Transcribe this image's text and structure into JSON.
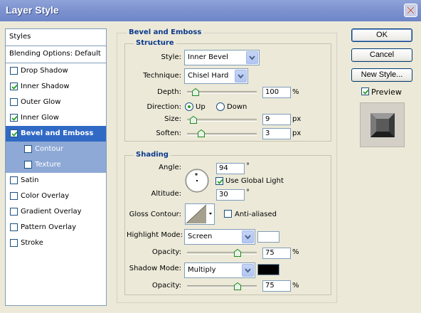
{
  "window": {
    "title": "Layer Style"
  },
  "styles_panel": {
    "header": "Styles",
    "blending": "Blending Options: Default",
    "items": [
      {
        "label": "Drop Shadow",
        "checked": false
      },
      {
        "label": "Inner Shadow",
        "checked": true
      },
      {
        "label": "Outer Glow",
        "checked": false
      },
      {
        "label": "Inner Glow",
        "checked": true
      },
      {
        "label": "Bevel and Emboss",
        "checked": true,
        "selected": true
      },
      {
        "label": "Contour",
        "checked": false,
        "sub": true
      },
      {
        "label": "Texture",
        "checked": false,
        "sub": true
      },
      {
        "label": "Satin",
        "checked": false
      },
      {
        "label": "Color Overlay",
        "checked": false
      },
      {
        "label": "Gradient Overlay",
        "checked": false
      },
      {
        "label": "Pattern Overlay",
        "checked": false
      },
      {
        "label": "Stroke",
        "checked": false
      }
    ]
  },
  "bevel": {
    "title": "Bevel and Emboss",
    "structure": {
      "title": "Structure",
      "style_label": "Style:",
      "style_value": "Inner Bevel",
      "technique_label": "Technique:",
      "technique_value": "Chisel Hard",
      "depth_label": "Depth:",
      "depth_value": "100",
      "depth_unit": "%",
      "depth_level": 0.08,
      "direction_label": "Direction:",
      "direction_up": "Up",
      "direction_down": "Down",
      "direction_selected": "Up",
      "size_label": "Size:",
      "size_value": "9",
      "size_unit": "px",
      "size_level": 0.04,
      "soften_label": "Soften:",
      "soften_value": "3",
      "soften_unit": "px",
      "soften_level": 0.17
    },
    "shading": {
      "title": "Shading",
      "angle_label": "Angle:",
      "angle_value": "94",
      "angle_unit": "°",
      "global_light_label": "Use Global Light",
      "global_light_checked": true,
      "altitude_label": "Altitude:",
      "altitude_value": "30",
      "altitude_unit": "°",
      "gloss_label": "Gloss Contour:",
      "anti_aliased_label": "Anti-aliased",
      "anti_aliased_checked": false,
      "highlight_mode_label": "Highlight Mode:",
      "highlight_mode_value": "Screen",
      "highlight_color": "#FFFFFF",
      "highlight_opacity_label": "Opacity:",
      "highlight_opacity_value": "75",
      "highlight_opacity_unit": "%",
      "highlight_opacity_level": 0.75,
      "shadow_mode_label": "Shadow Mode:",
      "shadow_mode_value": "Multiply",
      "shadow_color": "#000000",
      "shadow_opacity_label": "Opacity:",
      "shadow_opacity_value": "75",
      "shadow_opacity_unit": "%",
      "shadow_opacity_level": 0.75
    }
  },
  "buttons": {
    "ok": "OK",
    "cancel": "Cancel",
    "new_style": "New Style...",
    "preview_label": "Preview",
    "preview_checked": true
  }
}
